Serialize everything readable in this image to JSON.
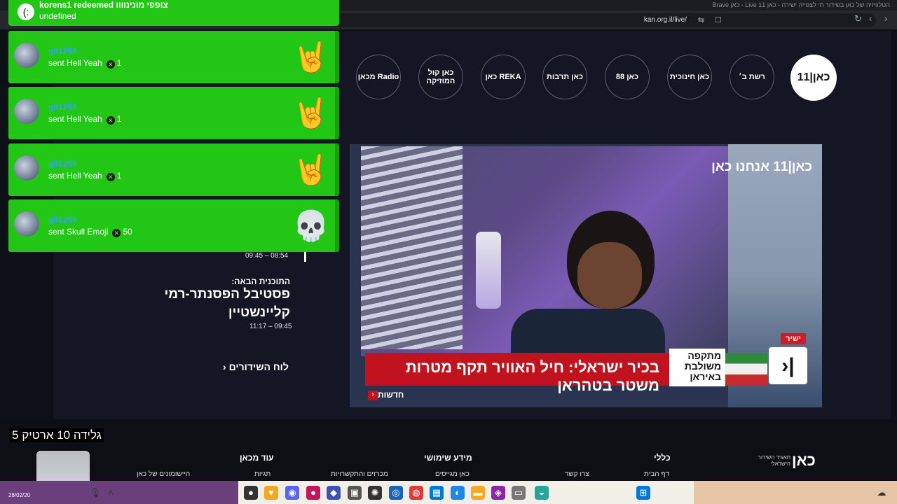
{
  "browser": {
    "window_title": "הטלוויזיה של כאן בשידור חי לצפייה ישירה - כאן 11 Live - כאן Brave",
    "url": "kan.org.il/live/"
  },
  "channels": [
    {
      "label": "כאן|11",
      "active": true
    },
    {
      "label": "רשת ב׳"
    },
    {
      "label": "כאן חינוכית"
    },
    {
      "label": "כאן 88"
    },
    {
      "label": "כאן תרבות"
    },
    {
      "label": "כאן REKA"
    },
    {
      "label": "כאן קול המוזיקה"
    },
    {
      "label": "מכאן Radio"
    }
  ],
  "video": {
    "channel_logo": "כאן|11 אנחנו כאן",
    "live_tag": "ישיר",
    "ticker_headline": "בכיר ישראלי: חיל האוויר תקף מטרות משטר בטהראן",
    "ticker_side": "מתקפה משולבת באיראן",
    "news_label": "חדשות"
  },
  "schedule": {
    "current_time": "09:45 – 08:54",
    "next_label": "התוכנית הבאה:",
    "next_title": "פסטיבל הפסנתר-רמי קליינשטיין",
    "next_time": "11:17 – 09:45",
    "link": "לוח השידורים"
  },
  "footer": {
    "org_name": "כאן",
    "org_sub": "תאגיד השידור הישראלי",
    "columns": [
      {
        "heading": "כללי",
        "item": "דף הבית"
      },
      {
        "heading": "",
        "item": "צרו קשר"
      },
      {
        "heading": "מידע שימושי",
        "item": "כאן מגייסים"
      },
      {
        "heading": "",
        "item": "מכרזים והתקשרויות"
      },
      {
        "heading": "עוד מכאן",
        "item": "תגיות"
      },
      {
        "heading": "",
        "item": "היישומונים של כאן"
      }
    ]
  },
  "overlay": {
    "redeem_title": "korens1 redeemed צופפי מונינוווו",
    "redeem_sub": "undefined",
    "alerts": [
      {
        "user": "gil1269",
        "action": "sent Hell Yeah",
        "count": "1",
        "emoji": "🤘"
      },
      {
        "user": "gil1269",
        "action": "sent Hell Yeah",
        "count": "1",
        "emoji": "🤘"
      },
      {
        "user": "gil1269",
        "action": "sent Hell Yeah",
        "count": "1",
        "emoji": "🤘"
      },
      {
        "user": "gil1269",
        "action": "sent Skull Emoji",
        "count": "50",
        "emoji": "💀"
      }
    ],
    "counter_text": "גלידה 10 ארטיק 5"
  },
  "taskbar": {
    "date": "28/02/20"
  }
}
